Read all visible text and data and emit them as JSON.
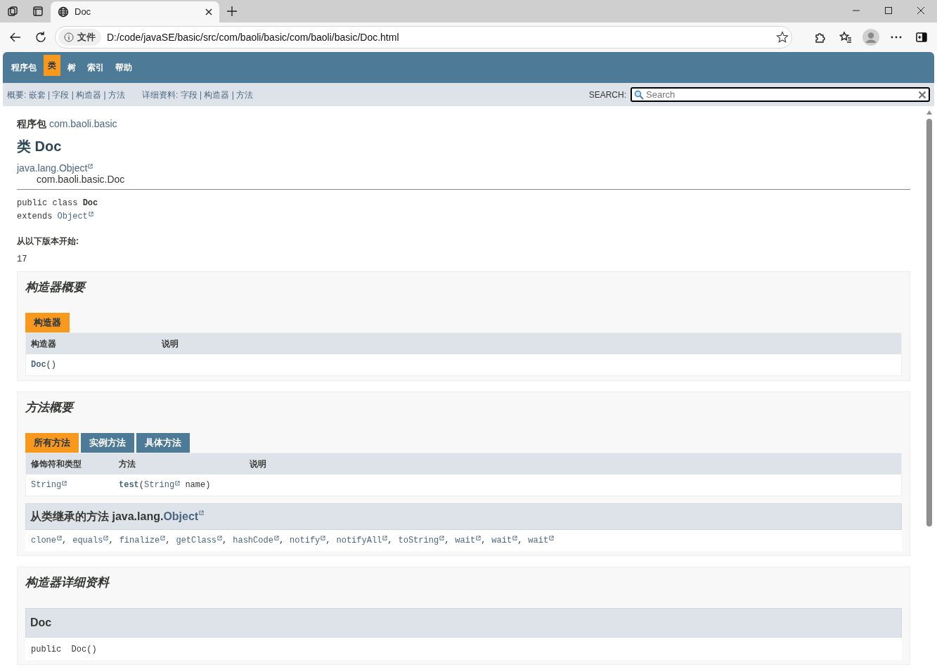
{
  "browser": {
    "tabs": [
      {
        "title": "Doc",
        "selected": true
      }
    ],
    "address": {
      "security_label": "文件",
      "url": "D:/code/javaSE/basic/src/com/baoli/basic/com/baoli/basic/Doc.html"
    }
  },
  "nav": {
    "items": [
      {
        "label": "程序包",
        "selected": false
      },
      {
        "label": "类",
        "selected": true
      },
      {
        "label": "树",
        "selected": false
      },
      {
        "label": "索引",
        "selected": false
      },
      {
        "label": "帮助",
        "selected": false
      }
    ]
  },
  "subnav": {
    "summary": "概要: 嵌套 | 字段 | 构造器 | 方法",
    "details": "详细资料: 字段 | 构造器 | 方法"
  },
  "search": {
    "label": "SEARCH:",
    "placeholder": "Search"
  },
  "package_line": {
    "label": "程序包",
    "name": "com.baoli.basic"
  },
  "title": "类 Doc",
  "inheritance": [
    {
      "text": "java.lang.Object",
      "kind": "external"
    },
    {
      "text": "com.baoli.basic.Doc",
      "kind": "plain"
    }
  ],
  "signature": [
    [
      {
        "text": "public class **Doc**",
        "kind": "plain"
      }
    ],
    [
      {
        "text": "extends",
        "kind": "plain",
        "space_after": true
      },
      {
        "text": "Object",
        "kind": "external"
      }
    ]
  ],
  "since": {
    "label": "从以下版本开始:",
    "value": "17"
  },
  "constructor_summary": {
    "heading": "构造器概要",
    "tabs": [
      {
        "label": "构造器",
        "selected": true
      }
    ],
    "columns": [
      "构造器",
      "说明"
    ],
    "rows": [
      [
        [
          {
            "text": "Doc",
            "kind": "link"
          },
          {
            "text": "()",
            "kind": "plain"
          }
        ],
        []
      ]
    ]
  },
  "method_summary": {
    "heading": "方法概要",
    "tabs": [
      {
        "label": "所有方法",
        "selected": true
      },
      {
        "label": "实例方法",
        "selected": false
      },
      {
        "label": "具体方法",
        "selected": false
      }
    ],
    "columns": [
      "修饰符和类型",
      "方法",
      "说明"
    ],
    "rows": [
      [
        [
          {
            "text": "String",
            "kind": "external"
          }
        ],
        [
          {
            "text": "test",
            "kind": "link"
          },
          {
            "text": "(",
            "kind": "plain"
          },
          {
            "text": "String",
            "kind": "external",
            "space_after": true
          },
          {
            "text": "name)",
            "kind": "plain"
          }
        ],
        []
      ]
    ]
  },
  "inherited": {
    "heading_prefix": "从类继承的方法 java.lang.",
    "heading_link": "Object",
    "methods": [
      {
        "name": "clone",
        "sep": ","
      },
      {
        "name": "equals",
        "sep": ","
      },
      {
        "name": "finalize",
        "sep": ","
      },
      {
        "name": "getClass",
        "sep": ","
      },
      {
        "name": "hashCode",
        "sep": ","
      },
      {
        "name": "notify",
        "sep": ","
      },
      {
        "name": "notifyAll",
        "sep": ","
      },
      {
        "name": "toString",
        "sep": ","
      },
      {
        "name": "wait",
        "sep": ","
      },
      {
        "name": "wait",
        "sep": ","
      },
      {
        "name": "wait"
      }
    ]
  },
  "constructor_details": {
    "heading": "构造器详细资料",
    "member": "Doc",
    "signature": "public  Doc()"
  }
}
